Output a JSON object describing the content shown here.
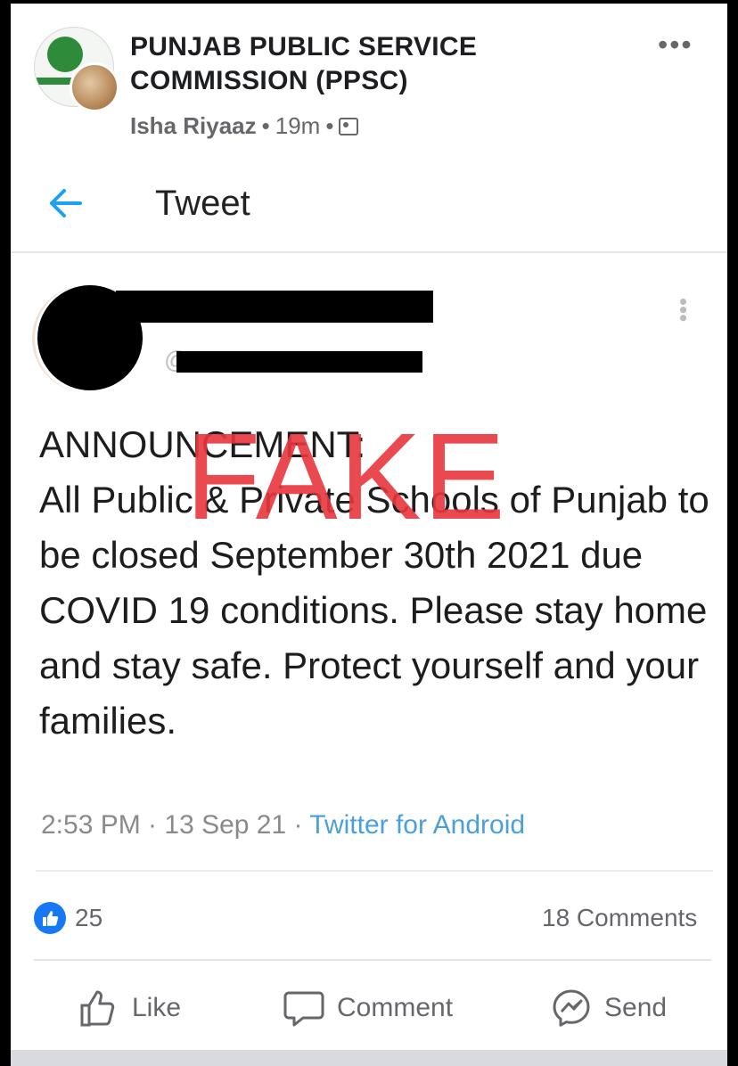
{
  "post": {
    "page_name": "PUNJAB PUBLIC SERVICE COMMISSION (PPSC)",
    "author": "Isha Riyaaz",
    "time": "19m",
    "audience_icon": "group-icon"
  },
  "tweet_view": {
    "heading": "Tweet",
    "handle_partial": "@",
    "text": "ANNOUNCEMENT:\nAll Public & Private Schools of Punjab to be closed  September 30th  2021 due COVID 19 conditions. Please stay home and stay safe. Protect yourself and your families.",
    "overlay_stamp": "FAKE",
    "timestamp": "2:53 PM · 13 Sep 21 · ",
    "source": "Twitter for Android"
  },
  "reactions": {
    "likes": "25",
    "comments": "18 Comments"
  },
  "actions": {
    "like": "Like",
    "comment": "Comment",
    "send": "Send"
  },
  "colors": {
    "accent": "#1877f2",
    "stamp": "#e8373d",
    "link": "#4aa0dd",
    "back_arrow": "#1da1f2"
  }
}
